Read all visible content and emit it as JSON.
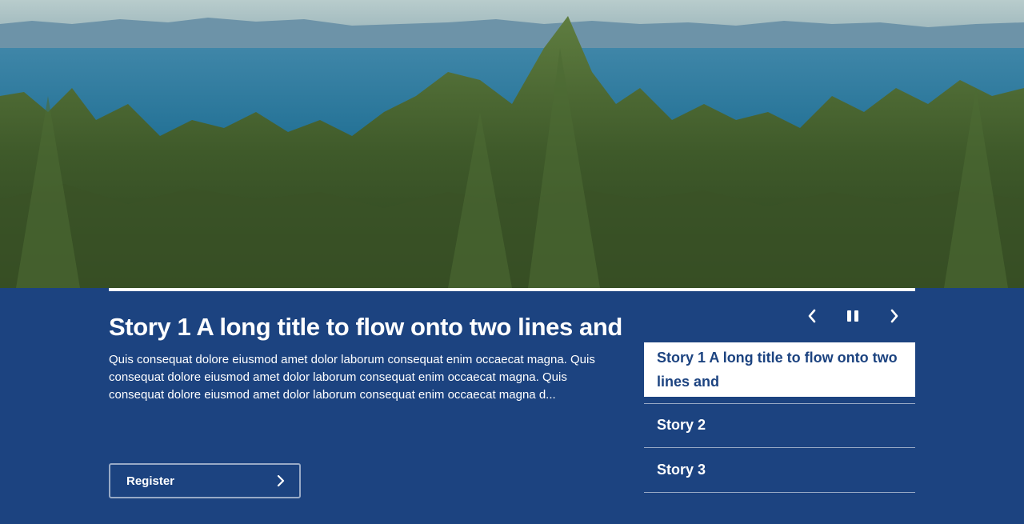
{
  "hero": {
    "image": "landscape-photo: sea, distant mountains, conifer forest"
  },
  "carousel": {
    "progress_fraction": 1.0,
    "current": {
      "title": "Story 1 A long title to flow onto two lines and",
      "description": "Quis consequat dolore eiusmod amet dolor laborum consequat enim occaecat magna. Quis consequat dolore eiusmod amet dolor laborum consequat enim occaecat magna. Quis consequat dolore eiusmod amet dolor laborum consequat enim occaecat magna d...",
      "cta_label": "Register",
      "cta_icon": "chevron-right-icon"
    },
    "controls": {
      "prev_icon": "chevron-left-icon",
      "pause_icon": "pause-icon",
      "next_icon": "chevron-right-icon"
    },
    "stories": [
      {
        "label": "Story 1 A long title to flow onto two lines and",
        "active": true
      },
      {
        "label": "Story 2",
        "active": false
      },
      {
        "label": "Story 3",
        "active": false
      }
    ]
  },
  "colors": {
    "panel_bg": "#1c4380",
    "text": "#ffffff",
    "active_item_bg": "#ffffff",
    "active_item_text": "#1c4380"
  }
}
